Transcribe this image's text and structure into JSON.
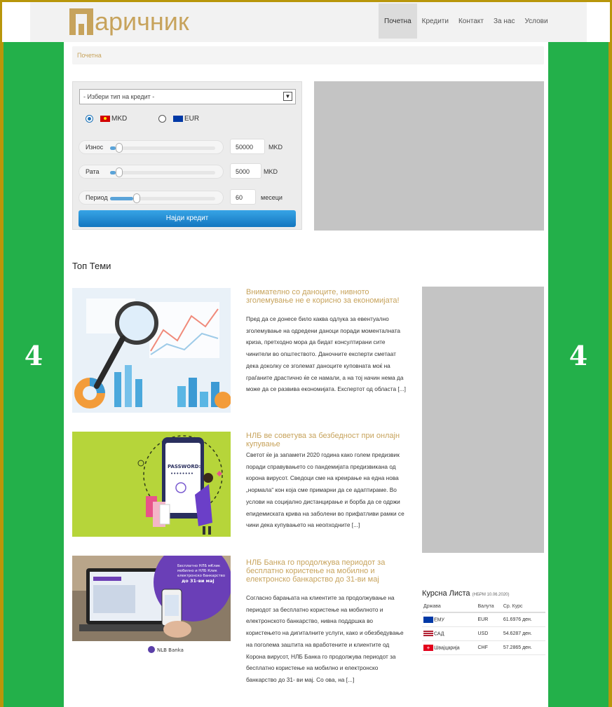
{
  "header": {
    "logo_text": "арични",
    "logo_suffix": "к",
    "nav": [
      "Почетна",
      "Кредити",
      "Контакт",
      "За нас",
      "Услови"
    ]
  },
  "breadcrumb": "Почетна",
  "side_number": "4",
  "calculator": {
    "select_value": "- Избери тип на кредит -",
    "currencies": [
      {
        "label": "MKD",
        "selected": true
      },
      {
        "label": "EUR",
        "selected": false
      }
    ],
    "rows": [
      {
        "label": "Износ",
        "value": "50000",
        "unit": "MKD",
        "slider_pct": 0.05
      },
      {
        "label": "Рата",
        "value": "5000",
        "unit": "MKD",
        "slider_pct": 0.05
      },
      {
        "label": "Период",
        "value": "60",
        "unit": "месеци",
        "slider_pct": 0.22
      }
    ],
    "button": "Најди кредит"
  },
  "section_title": "Топ Теми",
  "articles": [
    {
      "title": "Внимателно со даноците, нивното зголемување не е корисно за економијата!",
      "lines": [
        "Пред да се донесе било каква одлука за евентуално",
        "зголемување на одредени даноци поради моменталната",
        "криза, претходно мора да бидат консултирани сите",
        "чинители во општеството. Даночните експерти сметаат",
        "дека доколку се зголемат даноците куповната моќ на",
        "граѓаните драстично ќе се намали, а на тој начин нема да",
        "може да се развива економијата. Експертот од областа [...]"
      ]
    },
    {
      "title": "НЛБ ве советува за безбедност при онлајн купување",
      "image_text": "PASSWORD:",
      "lines": [
        "Светот ќе ја запамети 2020 година како голем предизвик",
        "поради справувањето со пандемијата предизвикана од",
        "корона вирусот. Сведоци сме на креирање на една нова",
        "„нормала“ кон која сме примарни да се адаптираме. Во",
        "услови на социјално дистанцирање и борба да се одржи",
        "епидемиската крива на заболени во прифатливи рамки се",
        "чини дека купувањето на неопходните [...]"
      ]
    },
    {
      "title": "НЛБ Банка го продолжува периодот за бесплатно користење на мобилно и електронско банкарство до 31-ви мај",
      "image_text": "Бесплатно НЛБ мКлик мобилно и НЛБ Клик електронско банкарство до 31-ви мај",
      "image_caption": "NLB Banka",
      "lines": [
        "Согласно барањата на клиентите за продолжување на",
        "периодот за бесплатно користење на мобилното и",
        "електронското банкарство, нивна поддршка во",
        "користењето на дигиталните услуги, како и обезбедување",
        "на поголема заштита на вработените и клиентите од",
        "Корона вирусот, НЛБ Банка го продолжува периодот за",
        "бесплатно користење на мобилно и електронско",
        "банкарство до 31- ви мај. Со ова, на [...]"
      ]
    }
  ],
  "rates": {
    "title": "Курсна Листа",
    "subtitle": "(НБРМ 10.06.2020)",
    "headers": [
      "Држава",
      "Валута",
      "Ср. Курс"
    ],
    "rows": [
      {
        "country": "ЕМУ",
        "currency": "EUR",
        "rate": "61.6976 ден.",
        "flag": "eu"
      },
      {
        "country": "САД",
        "currency": "USD",
        "rate": "54.6287 ден.",
        "flag": "us"
      },
      {
        "country": "Швајцарија",
        "currency": "CHF",
        "rate": "57.2865 ден.",
        "flag": "ch"
      }
    ]
  },
  "colors": {
    "gold": "#c7a35c",
    "green": "#23b04a",
    "border": "#b8960a",
    "button_blue": "#1a86d0"
  }
}
